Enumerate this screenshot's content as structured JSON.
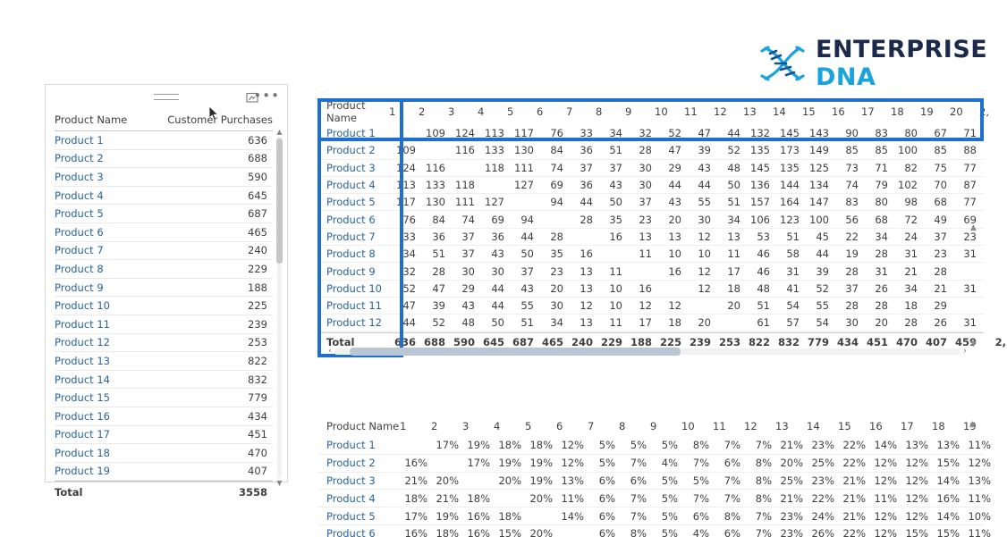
{
  "brand": {
    "name_primary": "ENTERPRISE",
    "name_secondary": "DNA",
    "color_primary": "#1b2a4a",
    "color_secondary": "#1aa3dd",
    "logo_icon": "dna-helix-icon"
  },
  "highlight_color": "#1f6fd0",
  "left_visual": {
    "columns": [
      "Product Name",
      "Customer Purchases"
    ],
    "rows": [
      {
        "name": "Product 1",
        "value": "636"
      },
      {
        "name": "Product 2",
        "value": "688"
      },
      {
        "name": "Product 3",
        "value": "590"
      },
      {
        "name": "Product 4",
        "value": "645"
      },
      {
        "name": "Product 5",
        "value": "687"
      },
      {
        "name": "Product 6",
        "value": "465"
      },
      {
        "name": "Product 7",
        "value": "240"
      },
      {
        "name": "Product 8",
        "value": "229"
      },
      {
        "name": "Product 9",
        "value": "188"
      },
      {
        "name": "Product 10",
        "value": "225"
      },
      {
        "name": "Product 11",
        "value": "239"
      },
      {
        "name": "Product 12",
        "value": "253"
      },
      {
        "name": "Product 13",
        "value": "822"
      },
      {
        "name": "Product 14",
        "value": "832"
      },
      {
        "name": "Product 15",
        "value": "779"
      },
      {
        "name": "Product 16",
        "value": "434"
      },
      {
        "name": "Product 17",
        "value": "451"
      },
      {
        "name": "Product 18",
        "value": "470"
      },
      {
        "name": "Product 19",
        "value": "407"
      }
    ],
    "total": {
      "label": "Total",
      "value": "3558"
    },
    "header_icons": [
      "focus-mode-icon",
      "more-options-icon",
      "drag-handle-icon"
    ]
  },
  "matrix_visual": {
    "corner_label": "Product Name",
    "columns": [
      "1",
      "2",
      "3",
      "4",
      "5",
      "6",
      "7",
      "8",
      "9",
      "10",
      "11",
      "12",
      "13",
      "14",
      "15",
      "16",
      "17",
      "18",
      "19",
      "20",
      "2,"
    ],
    "rows": [
      {
        "name": "Product 1",
        "values": [
          "",
          "109",
          "124",
          "113",
          "117",
          "76",
          "33",
          "34",
          "32",
          "52",
          "47",
          "44",
          "132",
          "145",
          "143",
          "90",
          "83",
          "80",
          "67",
          "71",
          ""
        ]
      },
      {
        "name": "Product 2",
        "values": [
          "109",
          "",
          "116",
          "133",
          "130",
          "84",
          "36",
          "51",
          "28",
          "47",
          "39",
          "52",
          "135",
          "173",
          "149",
          "85",
          "85",
          "100",
          "85",
          "88",
          ""
        ]
      },
      {
        "name": "Product 3",
        "values": [
          "124",
          "116",
          "",
          "118",
          "111",
          "74",
          "37",
          "37",
          "30",
          "29",
          "43",
          "48",
          "145",
          "135",
          "125",
          "73",
          "71",
          "82",
          "75",
          "77",
          ""
        ]
      },
      {
        "name": "Product 4",
        "values": [
          "113",
          "133",
          "118",
          "",
          "127",
          "69",
          "36",
          "43",
          "30",
          "44",
          "44",
          "50",
          "136",
          "144",
          "134",
          "74",
          "79",
          "102",
          "70",
          "87",
          ""
        ]
      },
      {
        "name": "Product 5",
        "values": [
          "117",
          "130",
          "111",
          "127",
          "",
          "94",
          "44",
          "50",
          "37",
          "43",
          "55",
          "51",
          "157",
          "164",
          "147",
          "83",
          "80",
          "98",
          "68",
          "77",
          ""
        ]
      },
      {
        "name": "Product 6",
        "values": [
          "76",
          "84",
          "74",
          "69",
          "94",
          "",
          "28",
          "35",
          "23",
          "20",
          "30",
          "34",
          "106",
          "123",
          "100",
          "56",
          "68",
          "72",
          "49",
          "69",
          ""
        ]
      },
      {
        "name": "Product 7",
        "values": [
          "33",
          "36",
          "37",
          "36",
          "44",
          "28",
          "",
          "16",
          "13",
          "13",
          "12",
          "13",
          "53",
          "51",
          "45",
          "22",
          "34",
          "24",
          "37",
          "23",
          ""
        ]
      },
      {
        "name": "Product 8",
        "values": [
          "34",
          "51",
          "37",
          "43",
          "50",
          "35",
          "16",
          "",
          "11",
          "10",
          "10",
          "11",
          "46",
          "58",
          "44",
          "19",
          "28",
          "31",
          "23",
          "31",
          ""
        ]
      },
      {
        "name": "Product 9",
        "values": [
          "32",
          "28",
          "30",
          "30",
          "37",
          "23",
          "13",
          "11",
          "",
          "16",
          "12",
          "17",
          "46",
          "31",
          "39",
          "28",
          "31",
          "21",
          "28",
          "",
          ""
        ]
      },
      {
        "name": "Product 10",
        "values": [
          "52",
          "47",
          "29",
          "44",
          "43",
          "20",
          "13",
          "10",
          "16",
          "",
          "12",
          "18",
          "48",
          "41",
          "52",
          "37",
          "26",
          "34",
          "21",
          "31",
          ""
        ]
      },
      {
        "name": "Product 11",
        "values": [
          "47",
          "39",
          "43",
          "44",
          "55",
          "30",
          "12",
          "10",
          "12",
          "12",
          "",
          "20",
          "51",
          "54",
          "55",
          "28",
          "28",
          "18",
          "29",
          "",
          ""
        ]
      },
      {
        "name": "Product 12",
        "values": [
          "44",
          "52",
          "48",
          "50",
          "51",
          "34",
          "13",
          "11",
          "17",
          "18",
          "20",
          "",
          "61",
          "57",
          "54",
          "30",
          "20",
          "28",
          "26",
          "31",
          ""
        ]
      }
    ],
    "total": {
      "label": "Total",
      "values": [
        "636",
        "688",
        "590",
        "645",
        "687",
        "465",
        "240",
        "229",
        "188",
        "225",
        "239",
        "253",
        "822",
        "832",
        "779",
        "434",
        "451",
        "470",
        "407",
        "459",
        "2,"
      ]
    },
    "scrollbars": {
      "horizontal": "horizontal-scrollbar",
      "vertical": "vertical-scrollbar"
    }
  },
  "percent_visual": {
    "corner_label": "Product Name",
    "columns": [
      "1",
      "2",
      "3",
      "4",
      "5",
      "6",
      "7",
      "8",
      "9",
      "10",
      "11",
      "12",
      "13",
      "14",
      "15",
      "16",
      "17",
      "18",
      "19",
      ""
    ],
    "rows": [
      {
        "name": "Product 1",
        "values": [
          "",
          "17%",
          "19%",
          "18%",
          "18%",
          "12%",
          "5%",
          "5%",
          "5%",
          "8%",
          "7%",
          "7%",
          "21%",
          "23%",
          "22%",
          "14%",
          "13%",
          "13%",
          "11%",
          ""
        ]
      },
      {
        "name": "Product 2",
        "values": [
          "16%",
          "",
          "17%",
          "19%",
          "19%",
          "12%",
          "5%",
          "7%",
          "4%",
          "7%",
          "6%",
          "8%",
          "20%",
          "25%",
          "22%",
          "12%",
          "12%",
          "15%",
          "12%",
          ""
        ]
      },
      {
        "name": "Product 3",
        "values": [
          "21%",
          "20%",
          "",
          "20%",
          "19%",
          "13%",
          "6%",
          "6%",
          "5%",
          "5%",
          "7%",
          "8%",
          "25%",
          "23%",
          "21%",
          "12%",
          "12%",
          "14%",
          "13%",
          ""
        ]
      },
      {
        "name": "Product 4",
        "values": [
          "18%",
          "21%",
          "18%",
          "",
          "20%",
          "11%",
          "6%",
          "7%",
          "5%",
          "7%",
          "7%",
          "8%",
          "21%",
          "22%",
          "21%",
          "11%",
          "12%",
          "16%",
          "11%",
          ""
        ]
      },
      {
        "name": "Product 5",
        "values": [
          "17%",
          "19%",
          "16%",
          "18%",
          "",
          "14%",
          "6%",
          "7%",
          "5%",
          "6%",
          "8%",
          "7%",
          "23%",
          "24%",
          "21%",
          "12%",
          "12%",
          "14%",
          "10%",
          ""
        ]
      },
      {
        "name": "Product 6",
        "values": [
          "16%",
          "18%",
          "16%",
          "15%",
          "20%",
          "",
          "6%",
          "8%",
          "5%",
          "4%",
          "6%",
          "7%",
          "23%",
          "26%",
          "22%",
          "12%",
          "15%",
          "15%",
          "11%",
          ""
        ]
      }
    ]
  }
}
